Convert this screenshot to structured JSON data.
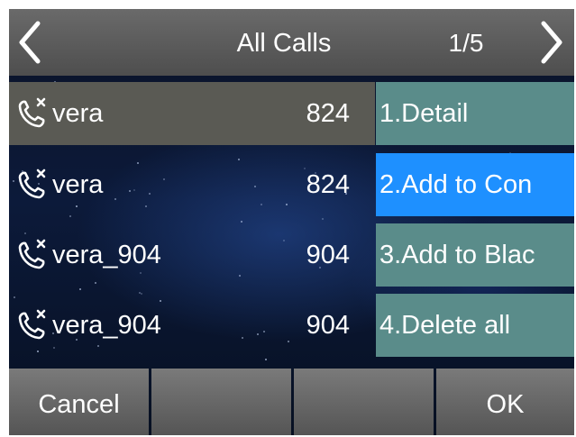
{
  "header": {
    "title": "All Calls",
    "page_indicator": "1/5",
    "prev_icon": "chevron-left-icon",
    "next_icon": "chevron-right-icon"
  },
  "calls": [
    {
      "name": "vera",
      "number": "824",
      "icon": "missed-call-icon",
      "selected": true
    },
    {
      "name": "vera",
      "number": "824",
      "icon": "missed-call-icon",
      "selected": false
    },
    {
      "name": "vera_904",
      "number": "904",
      "icon": "missed-call-icon",
      "selected": false
    },
    {
      "name": "vera_904",
      "number": "904",
      "icon": "missed-call-icon",
      "selected": false
    }
  ],
  "options_menu": [
    {
      "label": "1.Detail",
      "active": false
    },
    {
      "label": "2.Add to Con",
      "active": true
    },
    {
      "label": "3.Add to Blac",
      "active": false
    },
    {
      "label": "4.Delete all",
      "active": false
    }
  ],
  "softkeys": [
    "Cancel",
    "",
    "",
    "OK"
  ],
  "colors": {
    "header": "#5a5a5a",
    "selected_row": "#5a5a54",
    "menu_item": "#5a8c8a",
    "menu_active": "#1e90ff",
    "softkey": "#666666",
    "text": "#ffffff"
  }
}
